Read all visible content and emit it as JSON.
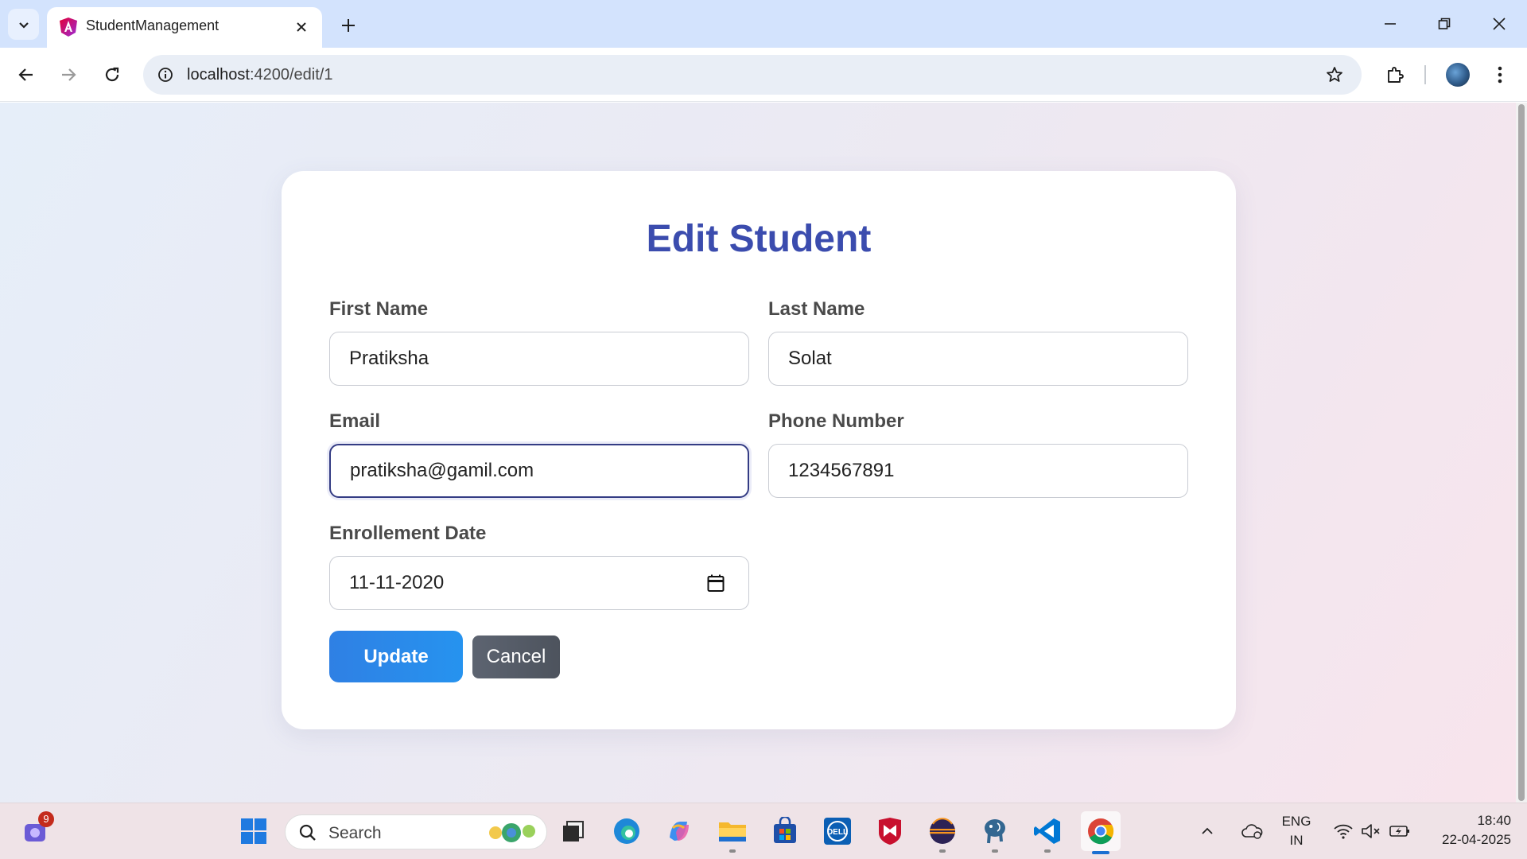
{
  "browser": {
    "tab_title": "StudentManagement",
    "url_host": "localhost",
    "url_path": ":4200/edit/1"
  },
  "form": {
    "title": "Edit Student",
    "first_name_label": "First Name",
    "first_name_value": "Pratiksha",
    "last_name_label": "Last Name",
    "last_name_value": "Solat",
    "email_label": "Email",
    "email_value": "pratiksha@gamil.com",
    "phone_label": "Phone Number",
    "phone_value": "1234567891",
    "enrollment_label": "Enrollement Date",
    "enrollment_value": "11-11-2020",
    "update_label": "Update",
    "cancel_label": "Cancel"
  },
  "taskbar": {
    "search_placeholder": "Search",
    "notification_count": "9",
    "language_line1": "ENG",
    "language_line2": "IN",
    "time": "18:40",
    "date": "22-04-2025",
    "apps": [
      "widgets-icon",
      "start-icon",
      "task-view-icon",
      "edge-icon",
      "copilot-icon",
      "file-explorer-icon",
      "store-icon",
      "dell-icon",
      "mcafee-icon",
      "eclipse-icon",
      "postgresql-icon",
      "vscode-icon",
      "chrome-icon"
    ]
  },
  "colors": {
    "title": "#3b4cae",
    "update_button": "#2f80e4",
    "cancel_button": "#5d6471",
    "focus_border": "#343c84"
  }
}
